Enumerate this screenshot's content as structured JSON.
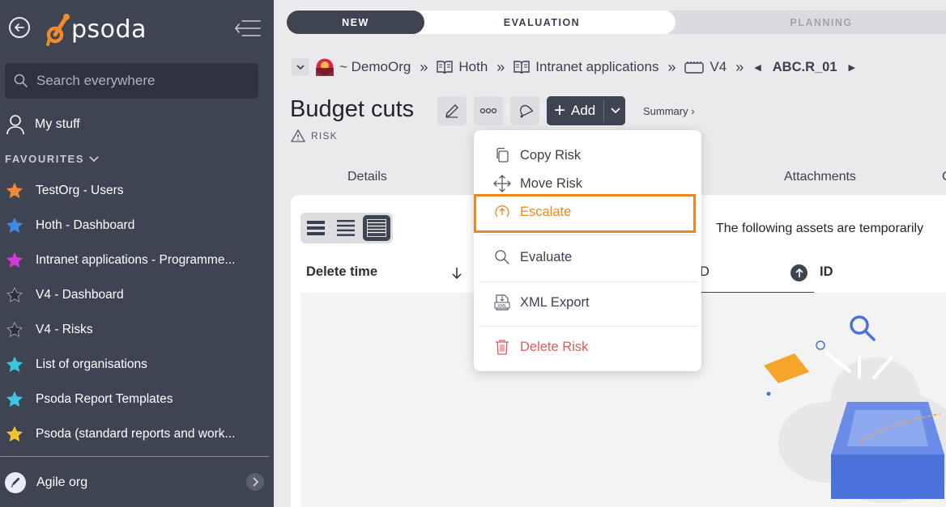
{
  "sidebar": {
    "logo_text": "psoda",
    "search_placeholder": "Search everywhere",
    "my_stuff": "My stuff",
    "favourites_header": "FAVOURITES",
    "favourites": [
      {
        "label": "TestOrg - Users",
        "color": "#f0883a"
      },
      {
        "label": "Hoth - Dashboard",
        "color": "#3d8be6"
      },
      {
        "label": "Intranet applications - Programme...",
        "color": "#d63ad6"
      },
      {
        "label": "V4 - Dashboard",
        "color": "#2b2f3a"
      },
      {
        "label": "V4 - Risks",
        "color": "#2b2f3a"
      },
      {
        "label": "List of organisations",
        "color": "#3cc6e0"
      },
      {
        "label": "Psoda Report Templates",
        "color": "#3cc6e0"
      },
      {
        "label": "Psoda (standard reports and work...",
        "color": "#f2c230"
      }
    ],
    "org": "Agile org"
  },
  "stages": {
    "new": "NEW",
    "evaluation": "EVALUATION",
    "planning": "PLANNING"
  },
  "breadcrumb": {
    "org": "~ DemoOrg",
    "program": "Hoth",
    "project": "Intranet applications",
    "version": "V4",
    "current": "ABC.R_01"
  },
  "page": {
    "title": "Budget cuts",
    "add_label": "Add",
    "summary_label": "Summary ›",
    "type_label": "RISK"
  },
  "tabs": {
    "details": "Details",
    "attachments": "Attachments",
    "clipped": "C"
  },
  "panel": {
    "notice": "The following assets are temporarily",
    "col_delete_time": "Delete time",
    "col_id_clipped": "D",
    "col_id": "ID"
  },
  "menu": {
    "copy": "Copy Risk",
    "move": "Move Risk",
    "escalate": "Escalate",
    "evaluate": "Evaluate",
    "xml_export": "XML Export",
    "delete": "Delete Risk"
  },
  "colors": {
    "sidebar": "#3f4453",
    "accent_orange": "#f0861f",
    "danger": "#e05a5a"
  }
}
